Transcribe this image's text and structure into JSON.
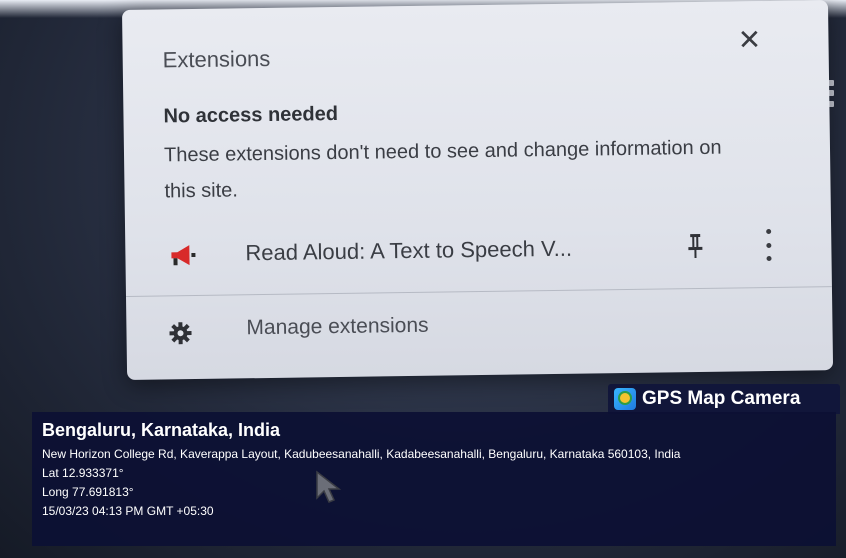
{
  "panel": {
    "title": "Extensions",
    "close_icon": "close-icon",
    "section_heading": "No access needed",
    "section_desc": "These extensions don't need to see and change information on this site.",
    "extensions": [
      {
        "name": "Read Aloud: A Text to Speech V...",
        "icon": "megaphone-icon",
        "pin_icon": "pin-icon",
        "more_icon": "more-vert-icon"
      }
    ],
    "manage": {
      "label": "Manage extensions",
      "icon": "gear-icon"
    }
  },
  "gps": {
    "app_name": "GPS Map Camera",
    "city": "Bengaluru, Karnataka, India",
    "address": "New Horizon College Rd, Kaverappa Layout, Kadubeesanahalli, Kadabeesanahalli, Bengaluru, Karnataka 560103, India",
    "lat": "Lat 12.933371°",
    "long": "Long 77.691813°",
    "timestamp": "15/03/23 04:13 PM GMT +05:30"
  },
  "colors": {
    "accent_red": "#d82a2a",
    "overlay_bg": "#0c1034",
    "panel_bg": "#e4e6ed"
  }
}
